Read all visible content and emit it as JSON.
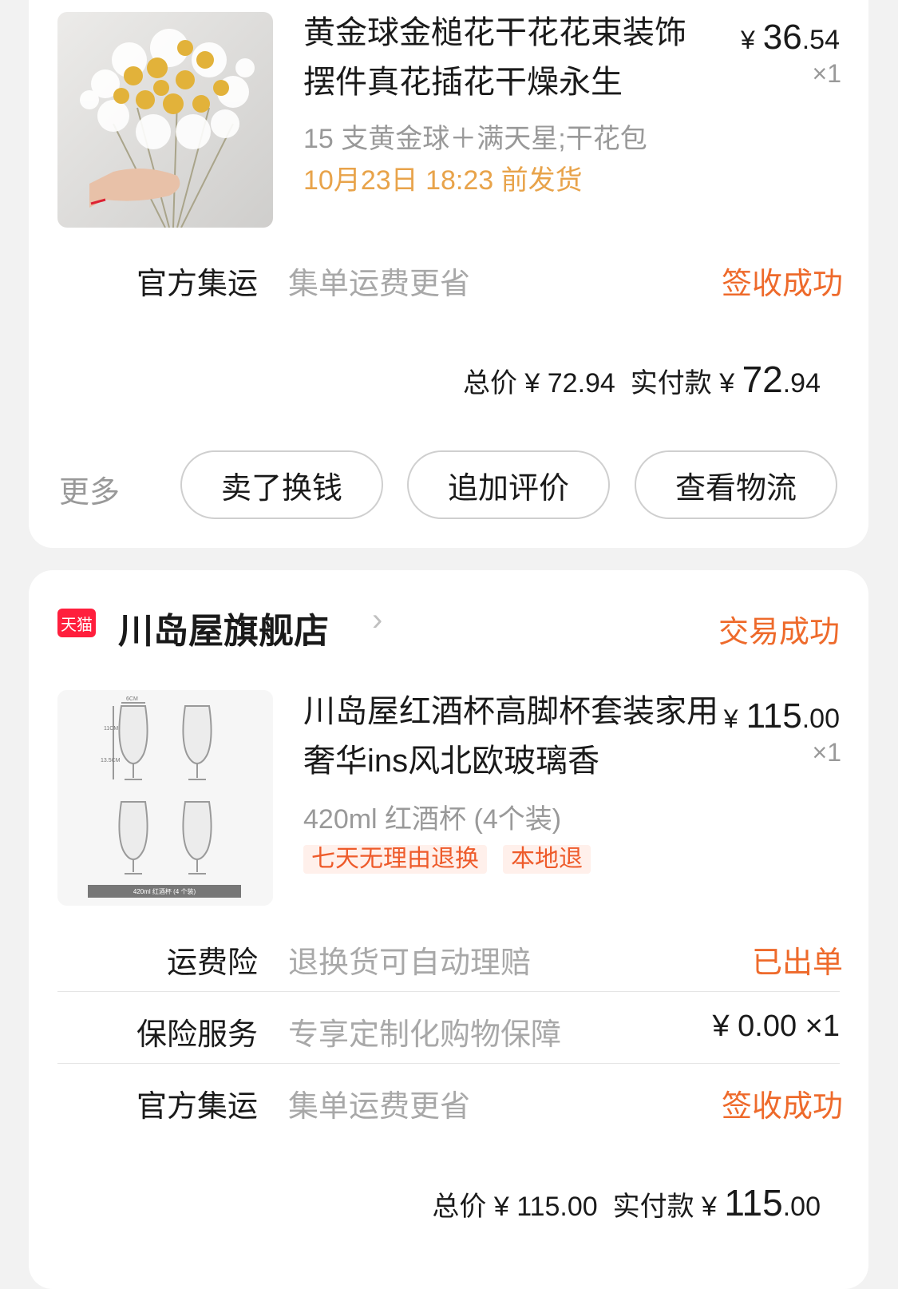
{
  "orders": [
    {
      "product": {
        "title": "黄金球金槌花干花花束装饰摆件真花插花干燥永生",
        "price_currency": "¥",
        "price_int": "36",
        "price_dec": ".54",
        "quantity": "×1",
        "sku": "15 支黄金球＋满天星;干花包",
        "ship_time": "10月23日 18:23 前发货"
      },
      "services": [
        {
          "label": "官方集运",
          "desc": "集单运费更省",
          "status": "签收成功"
        }
      ],
      "total": {
        "total_label": "总价 ¥ 72.94",
        "paid_label": "实付款 ¥",
        "paid_int": "72",
        "paid_dec": ".94"
      },
      "actions": {
        "more": "更多",
        "buttons": [
          "卖了换钱",
          "追加评价",
          "查看物流"
        ]
      }
    },
    {
      "shop": {
        "badge": "天猫",
        "name": "川岛屋旗舰店",
        "chevron": "›",
        "status": "交易成功"
      },
      "product": {
        "title": "川岛屋红酒杯高脚杯套装家用奢华ins风北欧玻璃香",
        "price_currency": "¥",
        "price_int": "115",
        "price_dec": ".00",
        "quantity": "×1",
        "sku": "420ml 红酒杯 (4个装)",
        "tags": [
          "七天无理由退换",
          "本地退"
        ],
        "image_caption": "420ml 红酒杯 (4 个装)",
        "image_dims": [
          "6CM",
          "11CM",
          "13.5CM"
        ]
      },
      "services": [
        {
          "label": "运费险",
          "desc": "退换货可自动理赔",
          "status": "已出单"
        },
        {
          "label": "保险服务",
          "desc": "专享定制化购物保障",
          "status": "¥ 0.00 ×1"
        },
        {
          "label": "官方集运",
          "desc": "集单运费更省",
          "status": "签收成功"
        }
      ],
      "total": {
        "total_label": "总价 ¥ 115.00",
        "paid_label": "实付款 ¥",
        "paid_int": "115",
        "paid_dec": ".00"
      }
    }
  ],
  "colors": {
    "accent_orange": "#ee6a2b",
    "ship_yellow": "#e8a34a",
    "tmall_red": "#ff1f3d",
    "muted_gray": "#999999"
  }
}
